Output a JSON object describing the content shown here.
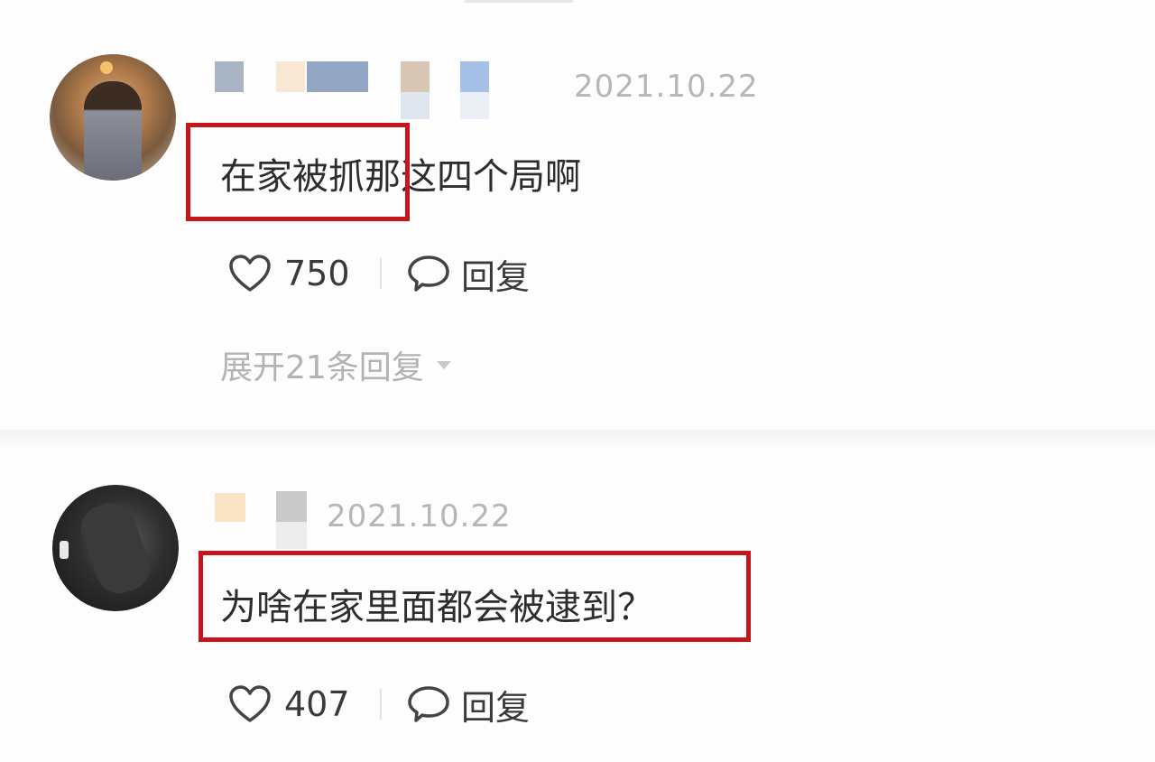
{
  "comments": [
    {
      "date": "2021.10.22",
      "text": "在家被抓那这四个局啊",
      "likes": "750",
      "reply_label": "回复",
      "expand_label": "展开21条回复"
    },
    {
      "date": "2021.10.22",
      "text": "为啥在家里面都会被逮到？",
      "likes": "407",
      "reply_label": "回复"
    }
  ],
  "colors": {
    "highlight_border": "#c4161c",
    "date_text": "#b6b6b6",
    "body_text": "#2d2d2d"
  },
  "icons": {
    "like": "heart-outline-icon",
    "reply": "speech-bubble-icon",
    "expand": "caret-down-icon"
  }
}
